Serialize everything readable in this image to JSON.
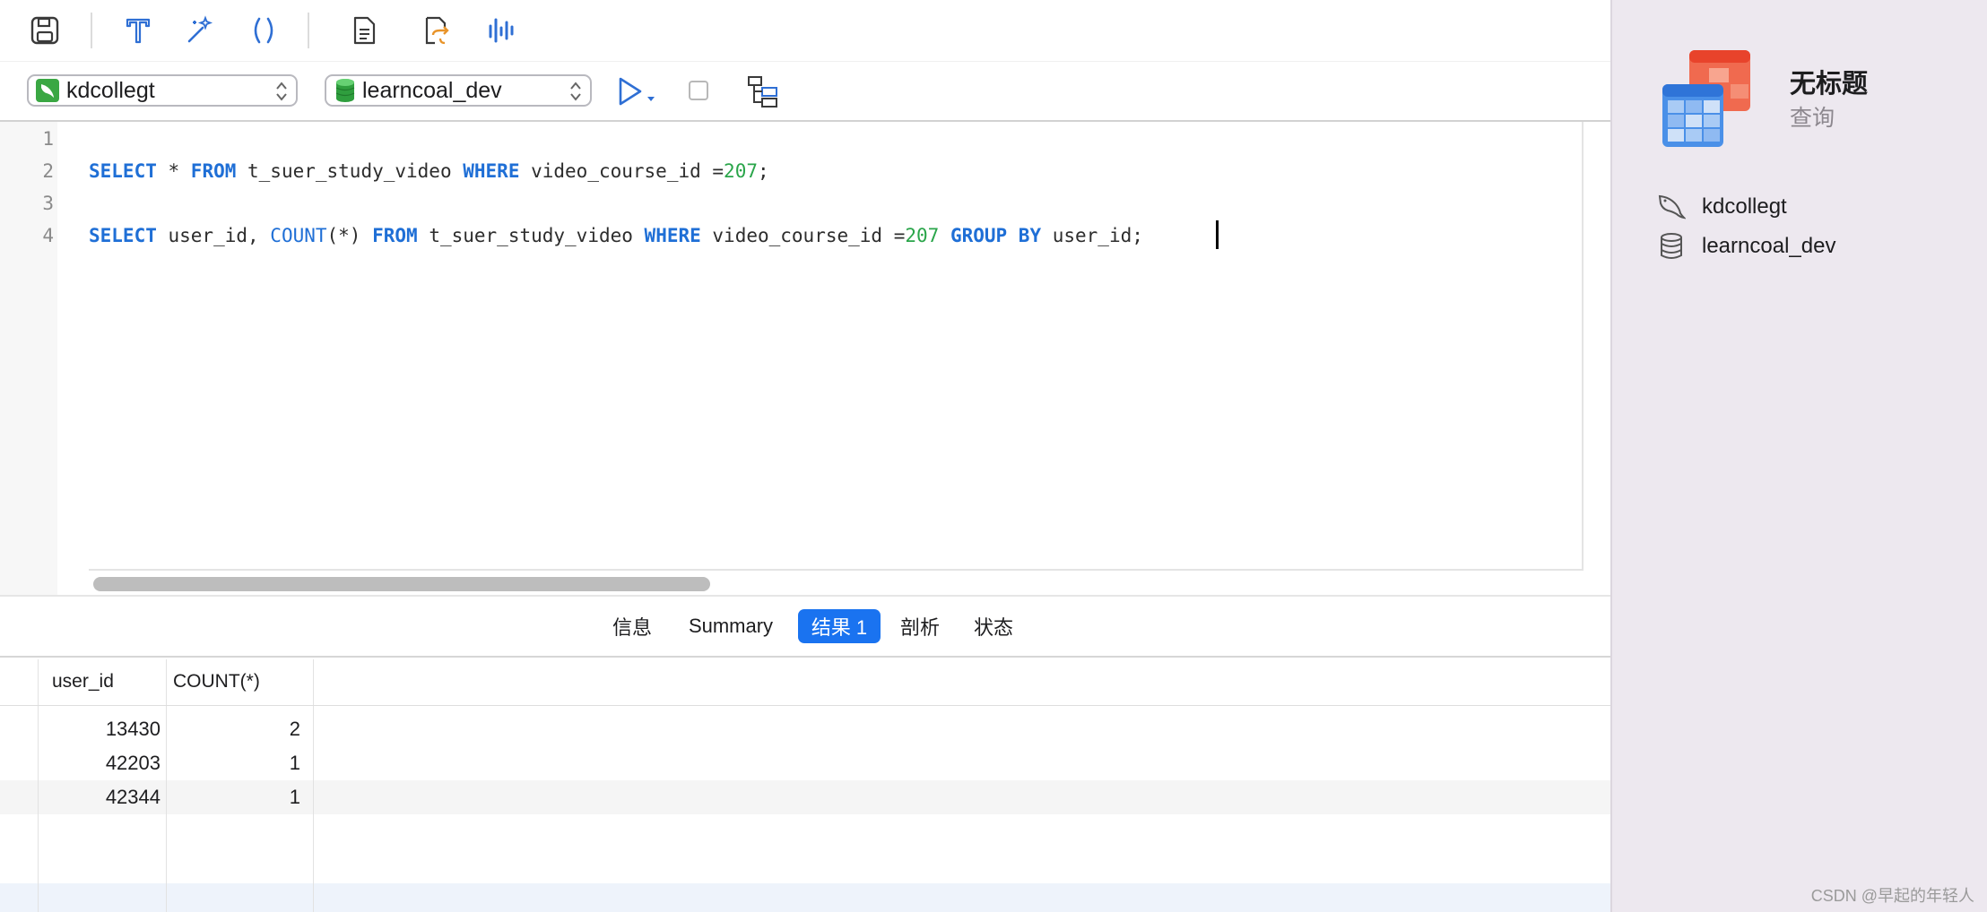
{
  "toolbar": {
    "icons": [
      "save-icon",
      "format-icon",
      "magic-wand-icon",
      "parentheses-icon",
      "document-icon",
      "export-icon",
      "chart-icon"
    ]
  },
  "connection": {
    "server": "kdcollegt",
    "database": "learncoal_dev"
  },
  "editor": {
    "line_numbers": [
      "1",
      "2",
      "3",
      "4"
    ],
    "line2": {
      "kw1": "SELECT",
      "t1": " * ",
      "kw2": "FROM",
      "t2": " t_suer_study_video ",
      "kw3": "WHERE",
      "t3": " video_course_id =",
      "num": "207",
      "t4": ";"
    },
    "line4": {
      "kw1": "SELECT",
      "t1": " user_id, ",
      "fn": "COUNT",
      "t2": "(*) ",
      "kw2": "FROM",
      "t3": " t_suer_study_video ",
      "kw3": "WHERE",
      "t4": " video_course_id =",
      "num": "207",
      "t5": " ",
      "kw4": "GROUP BY",
      "t6": " user_id;"
    }
  },
  "tabs": {
    "info": "信息",
    "summary": "Summary",
    "result1": "结果 1",
    "profile": "剖析",
    "status": "状态",
    "active": "结果 1"
  },
  "results": {
    "columns": [
      "user_id",
      "COUNT(*)"
    ],
    "rows": [
      [
        "13430",
        "2"
      ],
      [
        "42203",
        "1"
      ],
      [
        "42344",
        "1"
      ]
    ]
  },
  "side": {
    "title": "无标题",
    "subtitle": "查询",
    "server": "kdcollegt",
    "database": "learncoal_dev"
  },
  "watermark": "CSDN @早起的年轻人",
  "colors": {
    "accent": "#1a73f0",
    "keyword": "#1f6fd6",
    "number": "#2aa54a",
    "side_panel": "#ede8ef"
  }
}
